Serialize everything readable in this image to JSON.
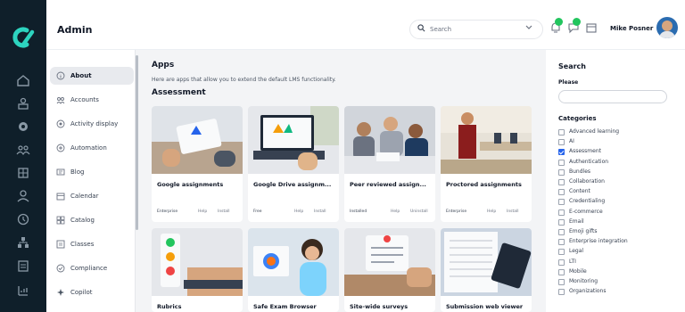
{
  "header": {
    "title": "Admin",
    "search_placeholder": "Search",
    "user_name": "Mike Posner"
  },
  "subnav": {
    "items": [
      {
        "label": "About",
        "icon": "info-circle-icon",
        "active": true
      },
      {
        "label": "Accounts",
        "icon": "users-icon"
      },
      {
        "label": "Activity display",
        "icon": "activity-icon"
      },
      {
        "label": "Automation",
        "icon": "automation-icon"
      },
      {
        "label": "Blog",
        "icon": "blog-icon"
      },
      {
        "label": "Calendar",
        "icon": "calendar-icon"
      },
      {
        "label": "Catalog",
        "icon": "catalog-icon"
      },
      {
        "label": "Classes",
        "icon": "classes-icon"
      },
      {
        "label": "Compliance",
        "icon": "compliance-icon"
      },
      {
        "label": "Copilot",
        "icon": "copilot-icon"
      }
    ]
  },
  "main": {
    "title": "Apps",
    "subtitle": "Here are apps that allow you to extend the default LMS functionality.",
    "section_title": "Assessment",
    "cards": [
      {
        "title": "Google assignments",
        "tag": "Enterprise",
        "help": "Help",
        "action": "Install"
      },
      {
        "title": "Google Drive assignm...",
        "tag": "Free",
        "help": "Help",
        "action": "Install"
      },
      {
        "title": "Peer reviewed assign...",
        "tag": "Installed",
        "help": "Help",
        "action": "Uninstall"
      },
      {
        "title": "Proctored assignments",
        "tag": "Enterprise",
        "help": "Help",
        "action": "Install"
      },
      {
        "title": "Rubrics"
      },
      {
        "title": "Safe Exam Browser"
      },
      {
        "title": "Site-wide surveys"
      },
      {
        "title": "Submission web viewer"
      }
    ]
  },
  "filter": {
    "title": "Search",
    "please_label": "Please",
    "categories_title": "Categories",
    "categories": [
      {
        "label": "Advanced learning",
        "checked": false
      },
      {
        "label": "AI",
        "checked": false
      },
      {
        "label": "Assessment",
        "checked": true
      },
      {
        "label": "Authentication",
        "checked": false
      },
      {
        "label": "Bundles",
        "checked": false
      },
      {
        "label": "Collaboration",
        "checked": false
      },
      {
        "label": "Content",
        "checked": false
      },
      {
        "label": "Credentialing",
        "checked": false
      },
      {
        "label": "E-commerce",
        "checked": false
      },
      {
        "label": "Email",
        "checked": false
      },
      {
        "label": "Emoji gifts",
        "checked": false
      },
      {
        "label": "Enterprise integration",
        "checked": false
      },
      {
        "label": "Legal",
        "checked": false
      },
      {
        "label": "LTI",
        "checked": false
      },
      {
        "label": "Mobile",
        "checked": false
      },
      {
        "label": "Monitoring",
        "checked": false
      },
      {
        "label": "Organizations",
        "checked": false
      }
    ]
  },
  "colors": {
    "rail": "#0f1f2a",
    "brand_logo": "#2dd4bf",
    "checkbox_accent": "#2563eb",
    "notification_badge": "#22c55e"
  }
}
